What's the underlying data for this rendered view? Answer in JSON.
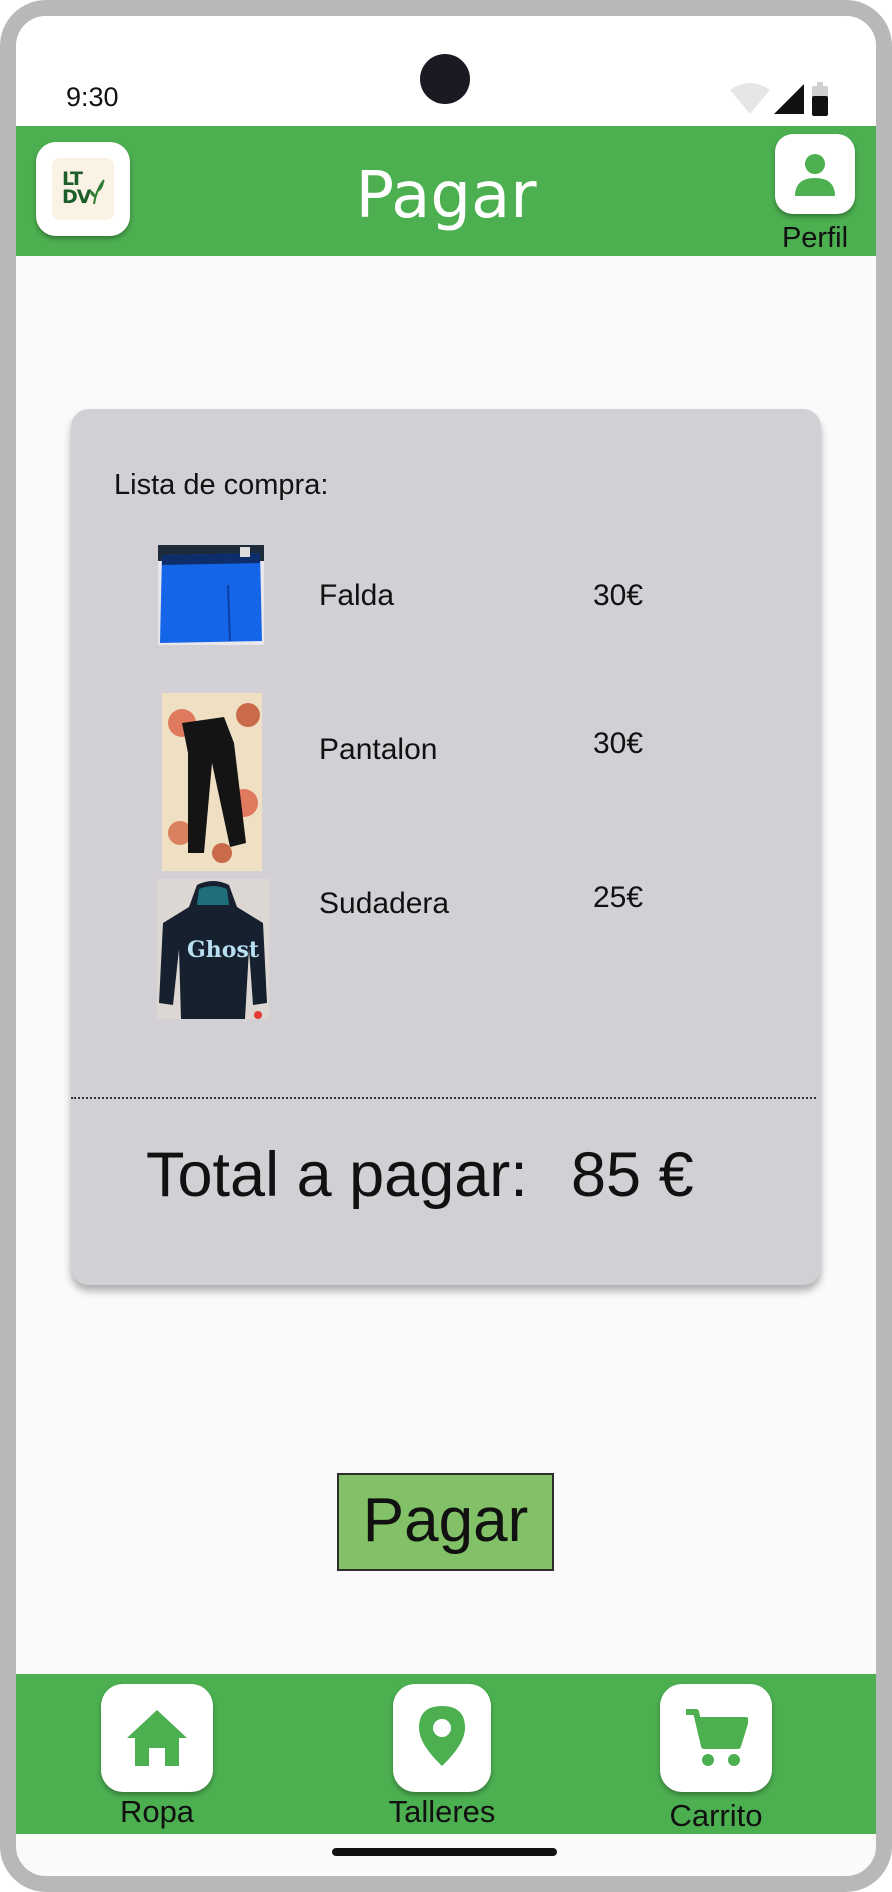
{
  "status_bar": {
    "time": "9:30"
  },
  "app_bar": {
    "logo_line1": "LT",
    "logo_line2": "DV",
    "title": "Pagar",
    "profile_label": "Perfil"
  },
  "cart": {
    "list_title": "Lista de compra:",
    "items": [
      {
        "name": "Falda",
        "price": "30€"
      },
      {
        "name": "Pantalon",
        "price": "30€"
      },
      {
        "name": "Sudadera",
        "price": "25€"
      }
    ],
    "total_label": "Total a pagar:",
    "total_value": "85 €"
  },
  "pay_button": {
    "label": "Pagar"
  },
  "bottom_nav": {
    "items": [
      {
        "label": "Ropa",
        "icon": "home-icon"
      },
      {
        "label": "Talleres",
        "icon": "location-pin-icon"
      },
      {
        "label": "Carrito",
        "icon": "shopping-cart-icon"
      }
    ]
  },
  "colors": {
    "primary": "#4caf50",
    "button": "#82c168",
    "card": "#d2d0d5"
  }
}
